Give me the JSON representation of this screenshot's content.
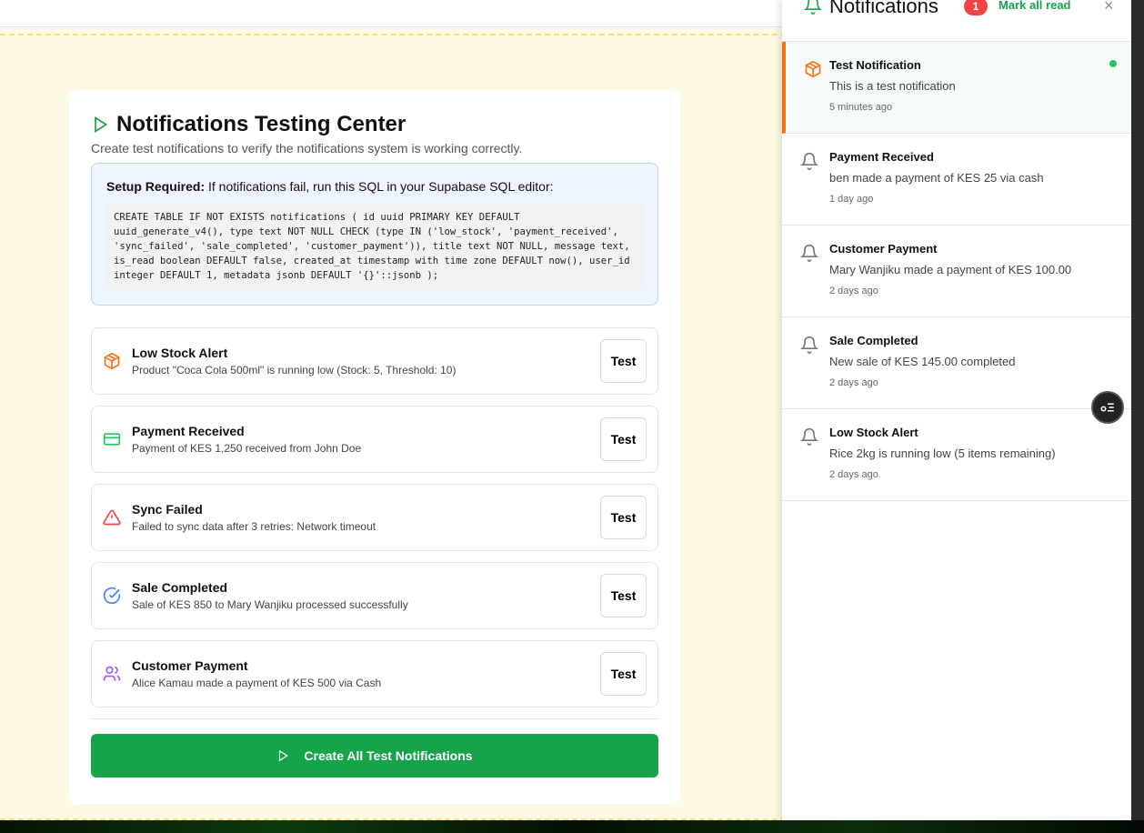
{
  "page": {
    "title": "Notifications Testing Center",
    "subtitle": "Create test notifications to verify the notifications system is working correctly."
  },
  "setup": {
    "label": "Setup Required:",
    "text": " If notifications fail, run this SQL in your Supabase SQL editor:",
    "sql": "CREATE TABLE IF NOT EXISTS notifications ( id uuid PRIMARY KEY DEFAULT uuid_generate_v4(), type text NOT NULL CHECK (type IN ('low_stock', 'payment_received', 'sync_failed', 'sale_completed', 'customer_payment')), title text NOT NULL, message text, is_read boolean DEFAULT false, created_at timestamp with time zone DEFAULT now(), user_id integer DEFAULT 1, metadata jsonb DEFAULT '{}'::jsonb );"
  },
  "tests": [
    {
      "title": "Low Stock Alert",
      "desc": "Product \"Coca Cola 500ml\" is running low (Stock: 5, Threshold: 10)",
      "icon": "package-icon",
      "color": "#f97316",
      "button": "Test"
    },
    {
      "title": "Payment Received",
      "desc": "Payment of KES 1,250 received from John Doe",
      "icon": "credit-card-icon",
      "color": "#22c55e",
      "button": "Test"
    },
    {
      "title": "Sync Failed",
      "desc": "Failed to sync data after 3 retries: Network timeout",
      "icon": "alert-triangle-icon",
      "color": "#ef4444",
      "button": "Test"
    },
    {
      "title": "Sale Completed",
      "desc": "Sale of KES 850 to Mary Wanjiku processed successfully",
      "icon": "check-circle-icon",
      "color": "#3b82f6",
      "button": "Test"
    },
    {
      "title": "Customer Payment",
      "desc": "Alice Kamau made a payment of KES 500 via Cash",
      "icon": "users-icon",
      "color": "#a855f7",
      "button": "Test"
    }
  ],
  "create_all": "Create All Test Notifications",
  "panel": {
    "title": "Notifications",
    "unread_count": "1",
    "mark_all": "Mark all read",
    "close": "×",
    "items": [
      {
        "title": "Test Notification",
        "message": "This is a test notification",
        "time": "5 minutes ago",
        "unread": true
      },
      {
        "title": "Payment Received",
        "message": "ben made a payment of KES 25 via cash",
        "time": "1 day ago"
      },
      {
        "title": "Customer Payment",
        "message": "Mary Wanjiku made a payment of KES 100.00",
        "time": "2 days ago"
      },
      {
        "title": "Sale Completed",
        "message": "New sale of KES 145.00 completed",
        "time": "2 days ago"
      },
      {
        "title": "Low Stock Alert",
        "message": "Rice 2kg is running low (5 items remaining)",
        "time": "2 days ago"
      }
    ]
  },
  "colors": {
    "accent": "#16a34a",
    "unread_border": "#f97316",
    "badge": "#ef4444"
  }
}
